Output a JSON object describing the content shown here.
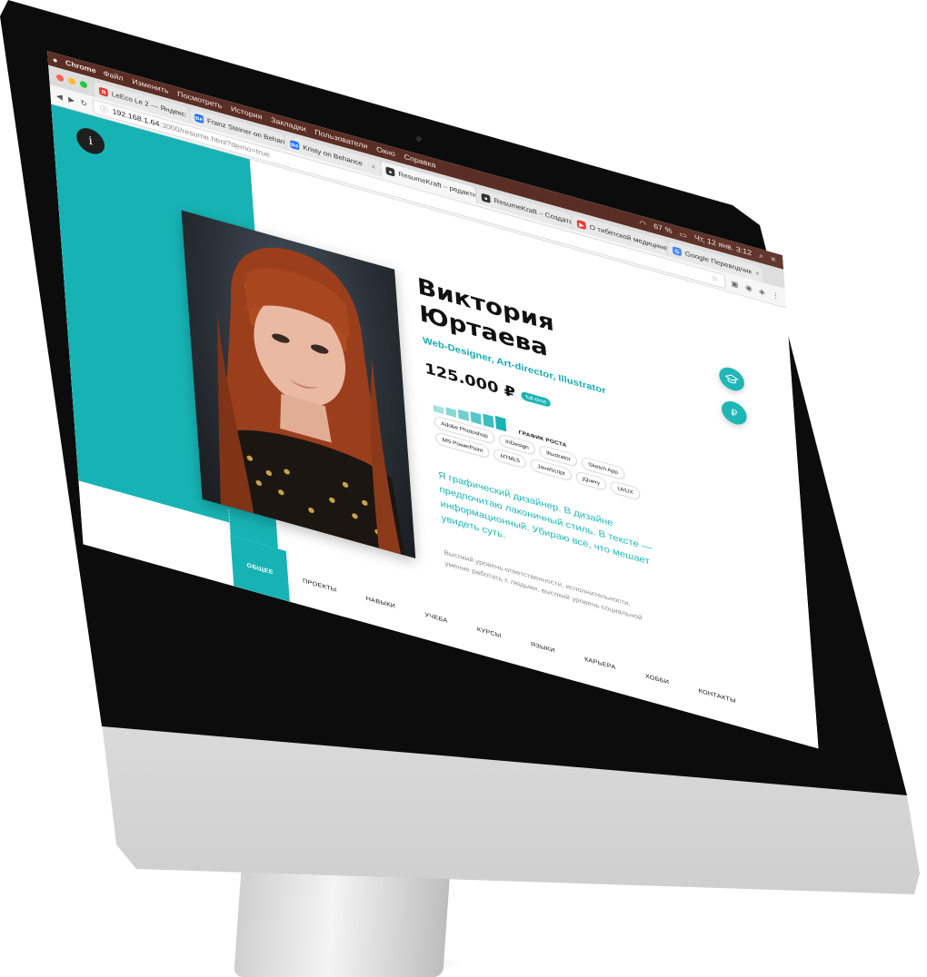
{
  "menubar": {
    "apple": "",
    "app": "Chrome",
    "items": [
      "Файл",
      "Изменить",
      "Посмотреть",
      "История",
      "Закладки",
      "Пользователи",
      "Окно",
      "Справка"
    ],
    "battery": "67 %",
    "clock": "Чт, 12 янв. 3:12"
  },
  "tabs": [
    {
      "title": "LeEco Le 2 — Яндекс: наш…",
      "favicon": "yandex-icon",
      "color": "#e53935"
    },
    {
      "title": "Franz Steiner on Behance",
      "favicon": "behance-icon",
      "color": "#1769ff"
    },
    {
      "title": "Kristy on Behance",
      "favicon": "behance-icon",
      "color": "#1769ff"
    },
    {
      "title": "ResumeKraft – редактиров…",
      "favicon": "apple-icon",
      "color": "#333333"
    },
    {
      "title": "ResumeKraft – Создать ре…",
      "favicon": "apple-icon",
      "color": "#333333"
    },
    {
      "title": "О тибетской медицине…",
      "favicon": "youtube-icon",
      "color": "#e53935"
    },
    {
      "title": "Google Переводчик",
      "favicon": "translate-icon",
      "color": "#4285f4"
    }
  ],
  "address": {
    "host": "192.168.1.64",
    "path": ":3000/resume.html?demo=true"
  },
  "profile": {
    "first_name": "Виктория",
    "last_name": "Юртаева",
    "role": "Web-Designer, Art-director, Illustrator",
    "salary": "125.000 ₽",
    "employment": "full-time"
  },
  "growth": {
    "label": "ГРАФИК РОСТА",
    "levels": [
      0.2,
      0.35,
      0.5,
      0.65,
      0.8,
      1.0
    ]
  },
  "skills": [
    "Adobe Photoshop",
    "InDesign",
    "Illustrator",
    "Sketch App",
    "MS PowerPoint",
    "HTML5",
    "JavaScript",
    "jQuery",
    "UI/UX"
  ],
  "bio": "Я графический дизайнер. В дизайне предпочитаю лаконичный стиль. В тексте — информационный. Убираю всё, что мешает увидеть суть.",
  "subtext": "Высокий уровень ответственности, исполнительности, умение работать с людьми, высокий уровень социальной",
  "nav": [
    "ОБЩЕЕ",
    "ПРОЕКТЫ",
    "НАВЫКИ",
    "УЧЕБА",
    "КУРСЫ",
    "ЯЗЫКИ",
    "КАРЬЕРА",
    "ХОББИ",
    "КОНТАКТЫ"
  ],
  "side_buttons": [
    "₽"
  ],
  "colors": {
    "accent": "#17b3b4",
    "menubar": "#5a2e25"
  }
}
